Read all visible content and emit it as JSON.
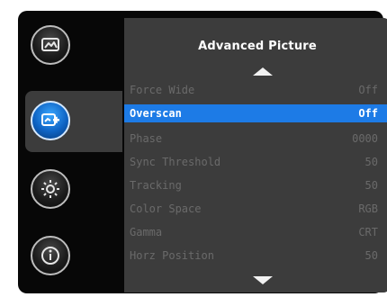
{
  "sidebar": {
    "items": [
      {
        "icon": "picture-icon",
        "active": false
      },
      {
        "icon": "advanced-picture-icon",
        "active": true
      },
      {
        "icon": "settings-gear-icon",
        "active": false
      },
      {
        "icon": "info-icon",
        "active": false
      }
    ]
  },
  "panel": {
    "title": "Advanced Picture",
    "rows": [
      {
        "label": "Force Wide",
        "value": "Off",
        "selected": false
      },
      {
        "label": "Overscan",
        "value": "Off",
        "selected": true
      },
      {
        "label": "Phase",
        "value": "0000",
        "selected": false
      },
      {
        "label": "Sync Threshold",
        "value": "50",
        "selected": false
      },
      {
        "label": "Tracking",
        "value": "50",
        "selected": false
      },
      {
        "label": "Color Space",
        "value": "RGB",
        "selected": false
      },
      {
        "label": "Gamma",
        "value": "CRT",
        "selected": false
      },
      {
        "label": "Horz Position",
        "value": "50",
        "selected": false
      }
    ]
  },
  "colors": {
    "accent": "#1d7be6",
    "panel": "#3c3c3c",
    "frame": "#070707",
    "dim_text": "#6a6a6a"
  }
}
